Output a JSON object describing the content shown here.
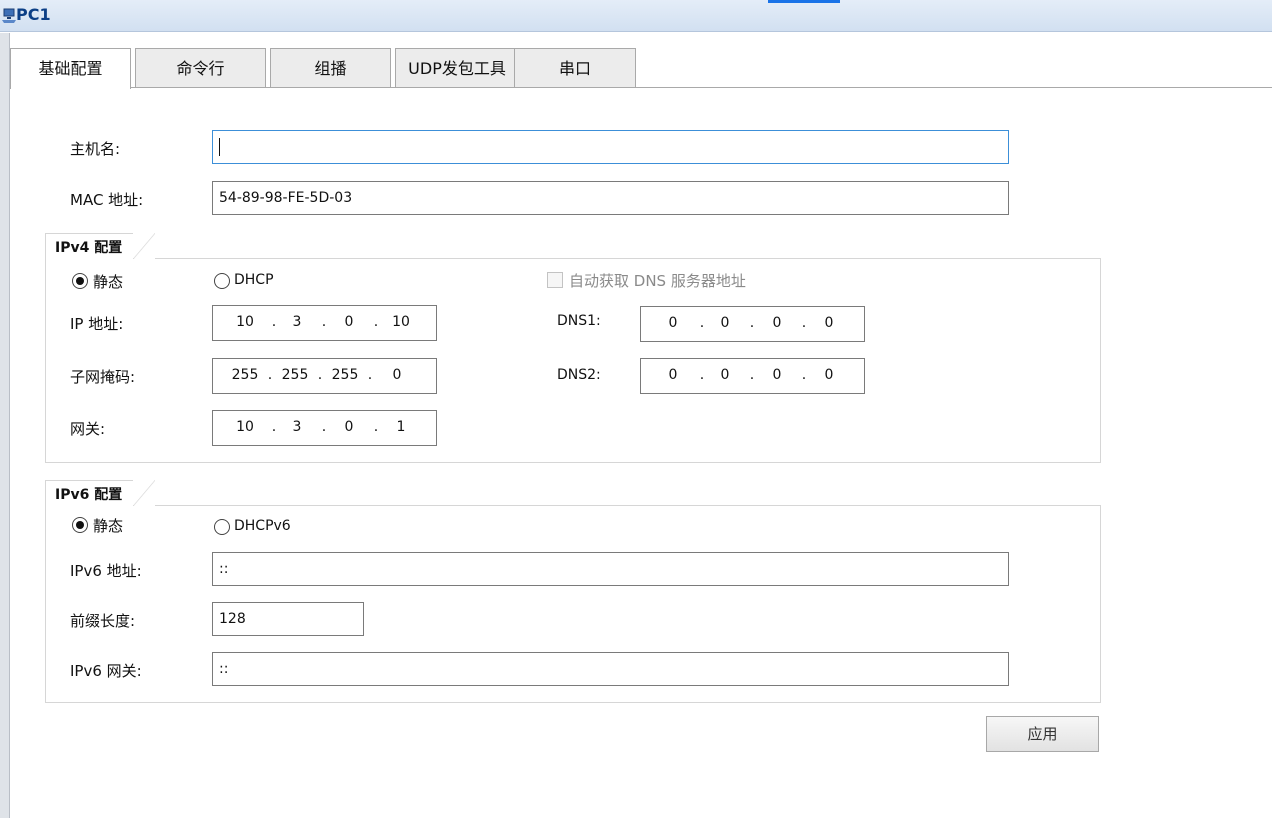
{
  "window": {
    "title": "PC1",
    "icon": "network-pc-icon"
  },
  "tabs": [
    {
      "label": "基础配置",
      "active": true
    },
    {
      "label": "命令行",
      "active": false
    },
    {
      "label": "组播",
      "active": false
    },
    {
      "label": "UDP发包工具",
      "active": false
    },
    {
      "label": "串口",
      "active": false
    }
  ],
  "basic": {
    "hostname_label": "主机名:",
    "hostname_value": "",
    "mac_label": "MAC 地址:",
    "mac_value": "54-89-98-FE-5D-03"
  },
  "ipv4": {
    "group_title": "IPv4 配置",
    "static_label": "静态",
    "dhcp_label": "DHCP",
    "mode": "static",
    "auto_dns_label": "自动获取 DNS 服务器地址",
    "auto_dns_checked": false,
    "ip_label": "IP 地址:",
    "ip": [
      "10",
      "3",
      "0",
      "10"
    ],
    "mask_label": "子网掩码:",
    "mask": [
      "255",
      "255",
      "255",
      "0"
    ],
    "gateway_label": "网关:",
    "gateway": [
      "10",
      "3",
      "0",
      "1"
    ],
    "dns1_label": "DNS1:",
    "dns1": [
      "0",
      "0",
      "0",
      "0"
    ],
    "dns2_label": "DNS2:",
    "dns2": [
      "0",
      "0",
      "0",
      "0"
    ]
  },
  "ipv6": {
    "group_title": "IPv6 配置",
    "static_label": "静态",
    "dhcp_label": "DHCPv6",
    "mode": "static",
    "addr_label": "IPv6 地址:",
    "addr_value": "::",
    "prefix_label": "前缀长度:",
    "prefix_value": "128",
    "gw_label": "IPv6 网关:",
    "gw_value": "::"
  },
  "apply_label": "应用",
  "colors": {
    "title": "#0c3f86",
    "accent": "#1a73e8",
    "focus_border": "#3c8fd8"
  }
}
